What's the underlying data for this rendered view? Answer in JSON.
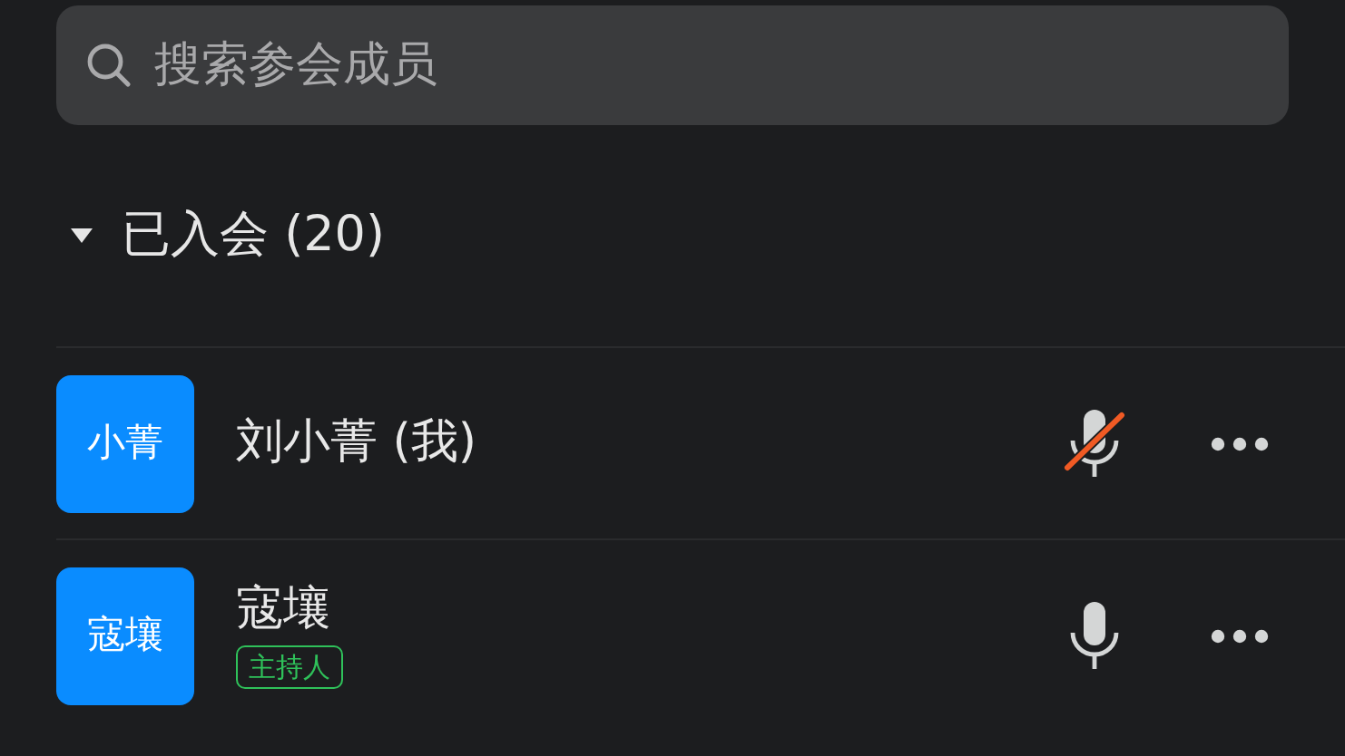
{
  "search": {
    "placeholder": "搜索参会成员"
  },
  "group": {
    "label": "已入会 (20)",
    "expanded": true
  },
  "members": [
    {
      "avatar_text": "小菁",
      "name": "刘小菁 (我)",
      "muted": true
    },
    {
      "avatar_text": "寇壤",
      "name": "寇壤",
      "role": "主持人",
      "muted": false
    }
  ]
}
